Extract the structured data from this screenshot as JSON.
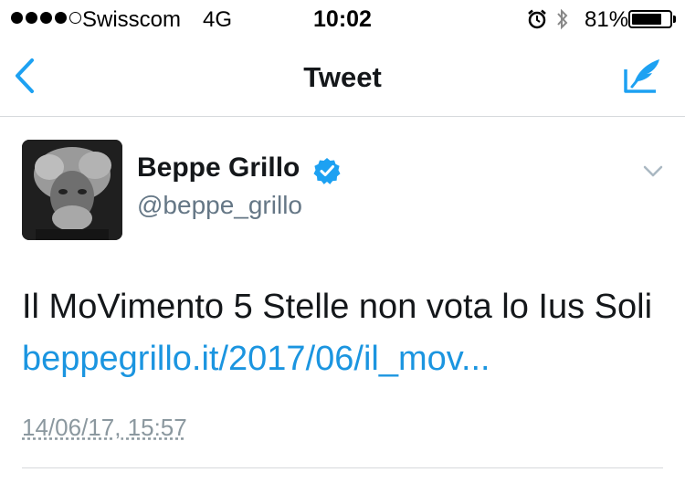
{
  "status_bar": {
    "carrier": "Swisscom",
    "network": "4G",
    "time": "10:02",
    "battery_percent": "81%",
    "battery_level": 0.81,
    "signal_bars": 4,
    "signal_total": 5
  },
  "nav": {
    "title": "Tweet",
    "back_icon": "chevron-left-icon",
    "compose_icon": "compose-tweet-icon",
    "accent_color": "#1da1f2"
  },
  "tweet": {
    "display_name": "Beppe Grillo",
    "handle": "@beppe_grillo",
    "verified": true,
    "text": "Il MoVimento 5 Stelle non vota lo Ius Soli ",
    "link": "beppegrillo.it/2017/06/il_mov...",
    "timestamp": "14/06/17, 15:57",
    "link_color": "#1b95e0"
  }
}
